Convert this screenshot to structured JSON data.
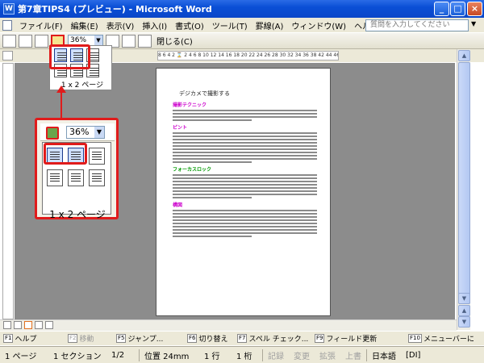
{
  "window": {
    "icon_letter": "W",
    "title": "第7章TIPS4 (プレビュー) - Microsoft Word",
    "buttons": [
      "_",
      "□",
      "×"
    ]
  },
  "menubar": {
    "items": [
      "ファイル(F)",
      "編集(E)",
      "表示(V)",
      "挿入(I)",
      "書式(O)",
      "ツール(T)",
      "罫線(A)",
      "ウィンドウ(W)",
      "ヘルプ(H)"
    ],
    "help_placeholder": "質問を入力してください",
    "help_arrow": "▼"
  },
  "toolbar": {
    "zoom": "36%",
    "zoom_arrow": "▼",
    "close_label": "閉じる(C)"
  },
  "ruler": {
    "text": "8 6 4 2 ⌛ 2 4 6 8 10 12 14 16 18 20 22 24 26 28 30 32 34 36 38  42 44 46 48"
  },
  "callout_small": {
    "label": "1 x 2 ページ"
  },
  "callout_big": {
    "zoom": "36%",
    "zoom_arrow": "▼",
    "label": "1 x 2 ページ"
  },
  "page": {
    "title": "デジカメで撮影する",
    "sections": [
      {
        "heading": "撮影テクニック",
        "color": "#cc00cc",
        "lines": 4
      },
      {
        "heading": "ピント",
        "color": "#cc00cc",
        "lines": 10
      },
      {
        "heading": "フォーカスロック",
        "color": "#009900",
        "lines": 8
      },
      {
        "heading": "構図",
        "color": "#cc00cc",
        "lines": 9
      }
    ]
  },
  "fnbar": {
    "keys": [
      {
        "key": "F1",
        "label": "ヘルプ",
        "dim": false
      },
      {
        "key": "F2",
        "label": "移動",
        "dim": true
      },
      {
        "key": "F5",
        "label": "ジャンプ...",
        "dim": false
      },
      {
        "key": "F6",
        "label": "切り替え",
        "dim": false
      },
      {
        "key": "F7",
        "label": "スペル チェック...",
        "dim": false
      },
      {
        "key": "F9",
        "label": "フィールド更新",
        "dim": false
      },
      {
        "key": "F10",
        "label": "メニューバーに",
        "dim": false
      }
    ]
  },
  "statusbar": {
    "page": "1 ページ",
    "section": "1 セクション",
    "pages": "1/2",
    "position": "位置 24mm",
    "line": "1 行",
    "column": "1 桁",
    "rec": "記録",
    "trk": "変更",
    "ext": "拡張",
    "ovr": "上書",
    "language": "日本語",
    "mode": "[DI]"
  },
  "colors": {
    "highlight_red": "#e01b1b",
    "titlebar_blue": "#0a4fd6"
  }
}
